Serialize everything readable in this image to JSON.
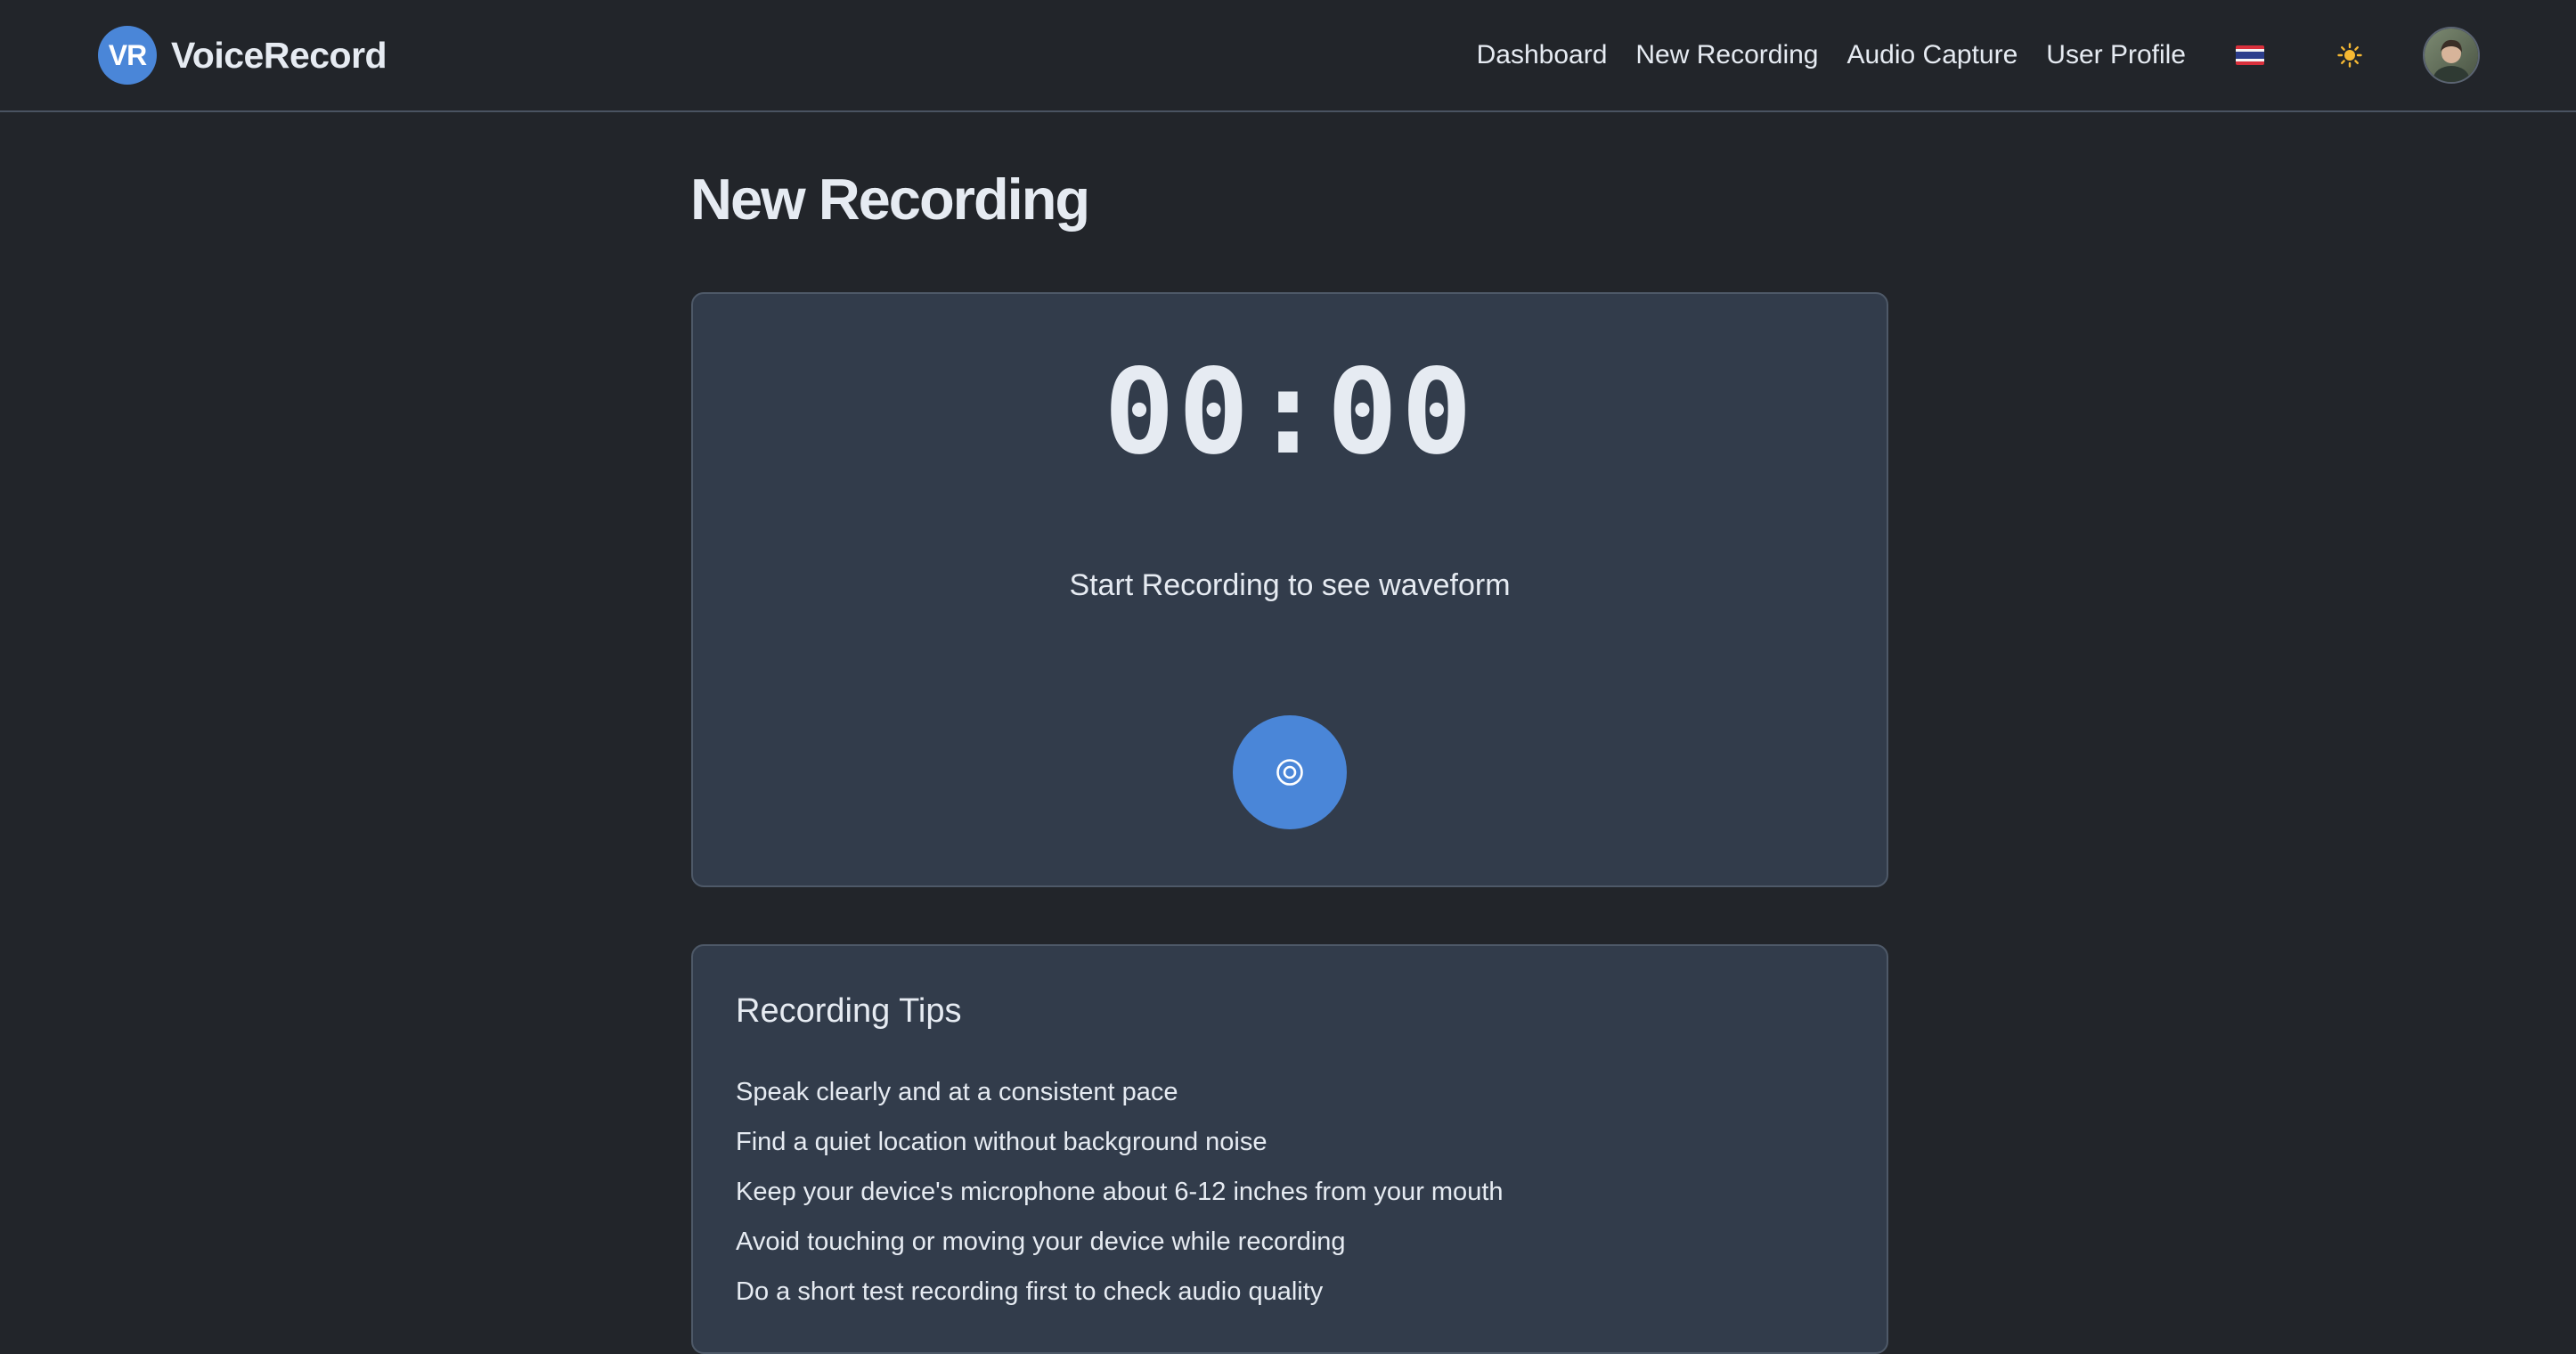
{
  "brand": {
    "initials": "VR",
    "name": "VoiceRecord"
  },
  "nav": {
    "items": [
      {
        "label": "Dashboard"
      },
      {
        "label": "New Recording"
      },
      {
        "label": "Audio Capture"
      },
      {
        "label": "User Profile"
      }
    ],
    "language_icon": "thai-flag-icon",
    "theme_icon": "sun-icon",
    "avatar_icon": "user-avatar"
  },
  "page": {
    "title": "New Recording"
  },
  "recorder": {
    "timer": "00:00",
    "waveform_placeholder": "Start Recording to see waveform",
    "record_button_icon": "record-icon"
  },
  "tips": {
    "title": "Recording Tips",
    "items": [
      "Speak clearly and at a consistent pace",
      "Find a quiet location without background noise",
      "Keep your device's microphone about 6-12 inches from your mouth",
      "Avoid touching or moving your device while recording",
      "Do a short test recording first to check audio quality"
    ]
  },
  "colors": {
    "background": "#22252a",
    "card": "#323c4b",
    "accent": "#4a86d8",
    "text": "#e6ebf2"
  }
}
